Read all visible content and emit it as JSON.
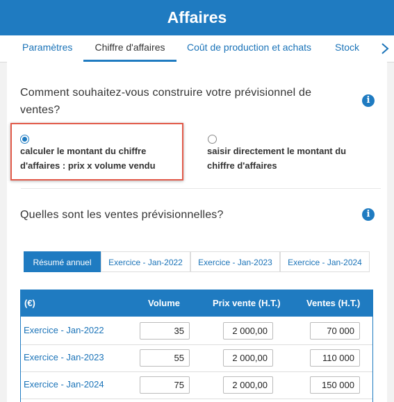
{
  "header": {
    "title": "Affaires"
  },
  "tabs": [
    {
      "label": "Paramètres"
    },
    {
      "label": "Chiffre d'affaires"
    },
    {
      "label": "Coût de production et achats"
    },
    {
      "label": "Stock"
    }
  ],
  "section1": {
    "question": "Comment souhaitez-vous construire votre prévisionnel de ventes?",
    "options": [
      {
        "label": "calculer le montant du chiffre d'affaires : prix x volume vendu",
        "selected": true
      },
      {
        "label": "saisir directement le montant du chiffre d'affaires",
        "selected": false
      }
    ]
  },
  "section2": {
    "question": "Quelles sont les ventes prévisionnelles?",
    "pills": [
      {
        "label": "Résumé annuel",
        "active": true
      },
      {
        "label": "Exercice - Jan-2022",
        "active": false
      },
      {
        "label": "Exercice - Jan-2023",
        "active": false
      },
      {
        "label": "Exercice - Jan-2024",
        "active": false
      }
    ],
    "table": {
      "headers": [
        "(€)",
        "Volume",
        "Prix vente (H.T.)",
        "Ventes (H.T.)"
      ],
      "rows": [
        {
          "label": "Exercice - Jan-2022",
          "volume": "35",
          "price": "2 000,00",
          "sales": "70 000"
        },
        {
          "label": "Exercice - Jan-2023",
          "volume": "55",
          "price": "2 000,00",
          "sales": "110 000"
        },
        {
          "label": "Exercice - Jan-2024",
          "volume": "75",
          "price": "2 000,00",
          "sales": "150 000"
        }
      ]
    }
  },
  "colors": {
    "primary": "#1f7bc1",
    "highlight": "#e25a4a"
  }
}
